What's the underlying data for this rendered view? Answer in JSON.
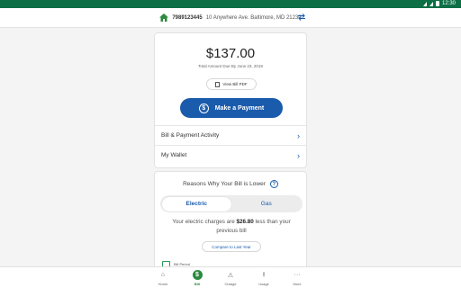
{
  "status_bar": {
    "time": "12:30"
  },
  "account": {
    "number": "7989123445",
    "address": "10 Anywhere Ave. Baltimore, MD 21230"
  },
  "bill": {
    "amount": "$137.00",
    "due_text": "Total Amount Due By June 23, 2019",
    "view_pdf_label": "View Bill PDF",
    "pay_label": "Make a Payment",
    "rows": [
      {
        "label": "Bill & Payment Activity"
      },
      {
        "label": "My Wallet"
      }
    ]
  },
  "reasons": {
    "title": "Reasons Why Your Bill is Lower",
    "toggle": {
      "electric": "Electric",
      "gas": "Gas",
      "selected": "Electric"
    },
    "compare_prefix": "Your electric charges are ",
    "compare_amount": "$26.80",
    "compare_suffix": " less than your previous bill",
    "compare_button": "Compare to Last Year",
    "bill_period_label": "Bill Period"
  },
  "tabs": [
    {
      "label": "Home",
      "icon": "home-icon"
    },
    {
      "label": "Bill",
      "icon": "dollar-icon",
      "active": true
    },
    {
      "label": "Outage",
      "icon": "outage-icon"
    },
    {
      "label": "Usage",
      "icon": "usage-icon"
    },
    {
      "label": "More",
      "icon": "more-icon"
    }
  ],
  "colors": {
    "brand_green": "#0e6f47",
    "primary_blue": "#1a5bab",
    "active_tab_green": "#2a8a3e"
  }
}
